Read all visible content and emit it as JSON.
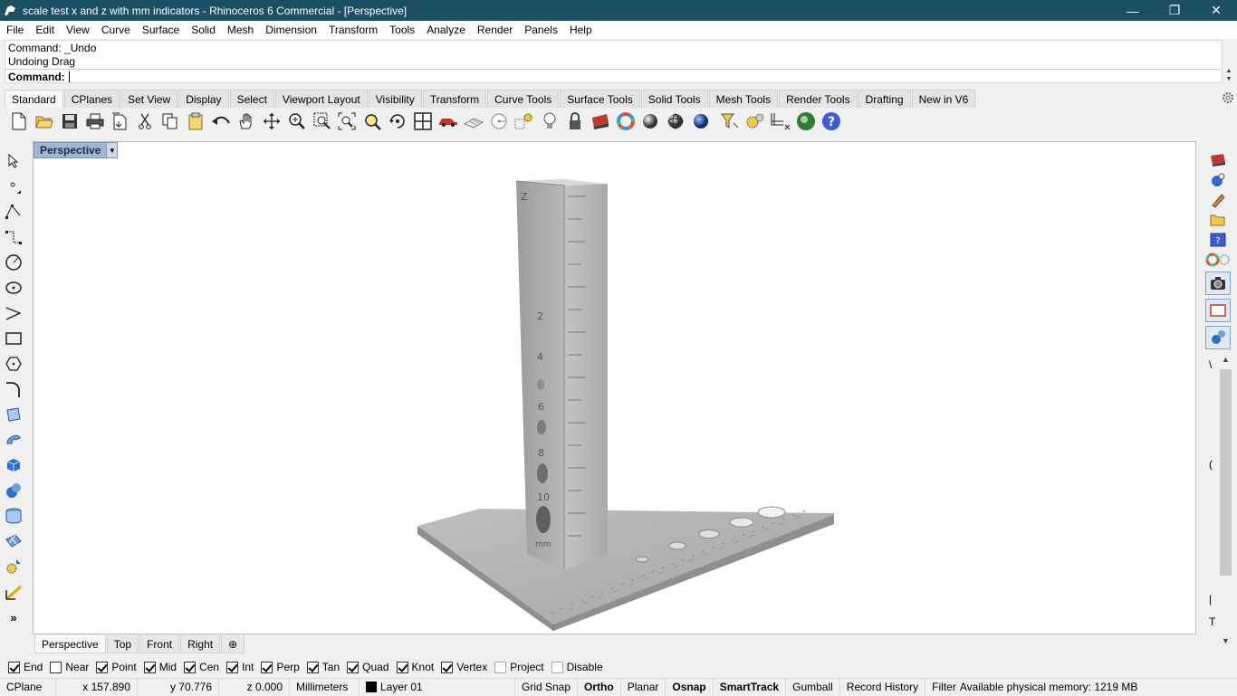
{
  "window": {
    "title": "scale test x and z with mm indicators - Rhinoceros 6 Commercial - [Perspective]",
    "buttons": {
      "minimize": "—",
      "restore": "❐",
      "close": "✕"
    }
  },
  "menu": [
    "File",
    "Edit",
    "View",
    "Curve",
    "Surface",
    "Solid",
    "Mesh",
    "Dimension",
    "Transform",
    "Tools",
    "Analyze",
    "Render",
    "Panels",
    "Help"
  ],
  "command": {
    "history": [
      "Command: _Undo",
      "Undoing Drag"
    ],
    "prompt": "Command:"
  },
  "tabs": [
    "Standard",
    "CPlanes",
    "Set View",
    "Display",
    "Select",
    "Viewport Layout",
    "Visibility",
    "Transform",
    "Curve Tools",
    "Surface Tools",
    "Solid Tools",
    "Mesh Tools",
    "Render Tools",
    "Drafting",
    "New in V6"
  ],
  "active_tab": "Standard",
  "toolbar_icons": [
    "new-file-icon",
    "open-icon",
    "save-icon",
    "print-icon",
    "import-icon",
    "cut-icon",
    "copy-icon",
    "paste-icon",
    "undo-icon",
    "pan-hand-icon",
    "move-view-icon",
    "zoom-icon",
    "zoom-window-icon",
    "zoom-extents-icon",
    "zoom-selected-icon",
    "rotate-view-icon",
    "viewport-layout-icon",
    "car-icon",
    "plane-icon",
    "circle-target-icon",
    "point-icon",
    "light-bulb-icon",
    "lock-icon",
    "layer-icon",
    "color-wheel-icon",
    "sphere-shaded-icon",
    "sphere-wire-icon",
    "render-sphere-icon",
    "filter-icon",
    "settings-gears-icon",
    "grid-icon",
    "globe-icon",
    "help-icon"
  ],
  "viewport": {
    "label": "Perspective",
    "model_labels": {
      "z_axis": "Z",
      "unit": "mm",
      "scale_marks": [
        "2",
        "4",
        "6",
        "8",
        "10"
      ]
    }
  },
  "viewport_tabs": [
    "Perspective",
    "Top",
    "Front",
    "Right"
  ],
  "active_viewport_tab": "Perspective",
  "right_panel_letters": [
    "\\",
    "(",
    "|",
    "T"
  ],
  "osnaps": [
    {
      "label": "End",
      "checked": true
    },
    {
      "label": "Near",
      "checked": false
    },
    {
      "label": "Point",
      "checked": true
    },
    {
      "label": "Mid",
      "checked": true
    },
    {
      "label": "Cen",
      "checked": true
    },
    {
      "label": "Int",
      "checked": true
    },
    {
      "label": "Perp",
      "checked": true
    },
    {
      "label": "Tan",
      "checked": true
    },
    {
      "label": "Quad",
      "checked": true
    },
    {
      "label": "Knot",
      "checked": true
    },
    {
      "label": "Vertex",
      "checked": true
    },
    {
      "label": "Project",
      "checked": false
    },
    {
      "label": "Disable",
      "checked": false
    }
  ],
  "status": {
    "cplane": "CPlane",
    "x": "x 157.890",
    "y": "y 70.776",
    "z": "z 0.000",
    "units": "Millimeters",
    "layer": "Layer 01",
    "grid_snap": "Grid Snap",
    "ortho": "Ortho",
    "planar": "Planar",
    "osnap": "Osnap",
    "smarttrack": "SmartTrack",
    "gumball": "Gumball",
    "record_history": "Record History",
    "filter": "Filter",
    "memory": "Available physical memory: 1219 MB"
  },
  "colors": {
    "titlebar": "#1b4f63",
    "viewport_label": "#9eb7d6",
    "model_gray": "#a6a6a6"
  }
}
